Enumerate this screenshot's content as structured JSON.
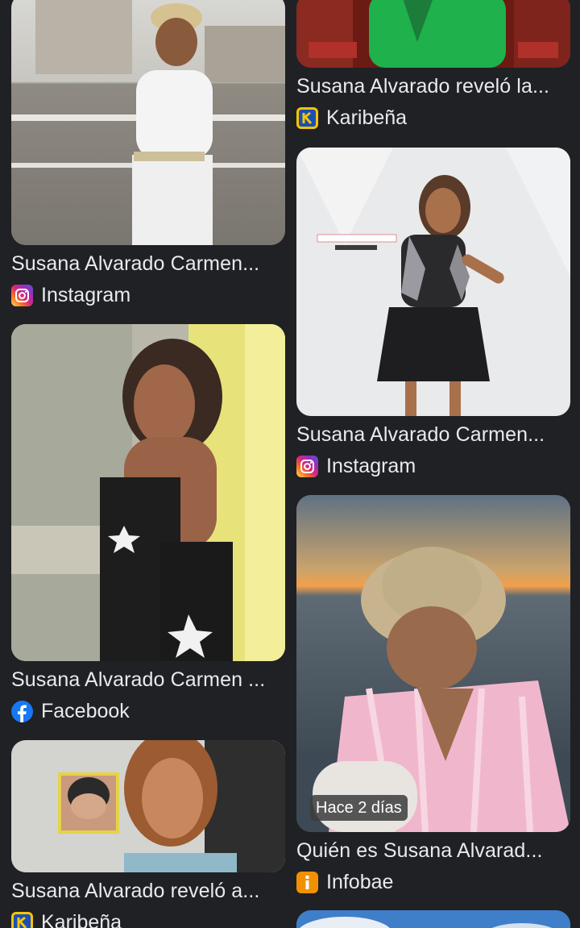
{
  "results": {
    "left": [
      {
        "title": "Susana Alvarado Carmen...",
        "source": "Instagram",
        "icon": "instagram-icon"
      },
      {
        "title": "Susana Alvarado Carmen ...",
        "source": "Facebook",
        "icon": "facebook-icon"
      },
      {
        "title": "Susana Alvarado reveló a...",
        "source": "Karibeña",
        "icon": "karibena-icon"
      }
    ],
    "right": [
      {
        "title": "Susana Alvarado reveló la...",
        "source": "Karibeña",
        "icon": "karibena-icon"
      },
      {
        "title": "Susana Alvarado Carmen...",
        "source": "Instagram",
        "icon": "instagram-icon"
      },
      {
        "title": "Quién es Susana Alvarad...",
        "source": "Infobae",
        "icon": "infobae-icon",
        "badge": "Hace 2 días"
      }
    ]
  },
  "colors": {
    "background": "#202124",
    "text": "#e8eaed",
    "instagram": "#d62976",
    "facebook": "#1877f2",
    "karibena": "#f5c400",
    "infobae": "#f29100"
  }
}
